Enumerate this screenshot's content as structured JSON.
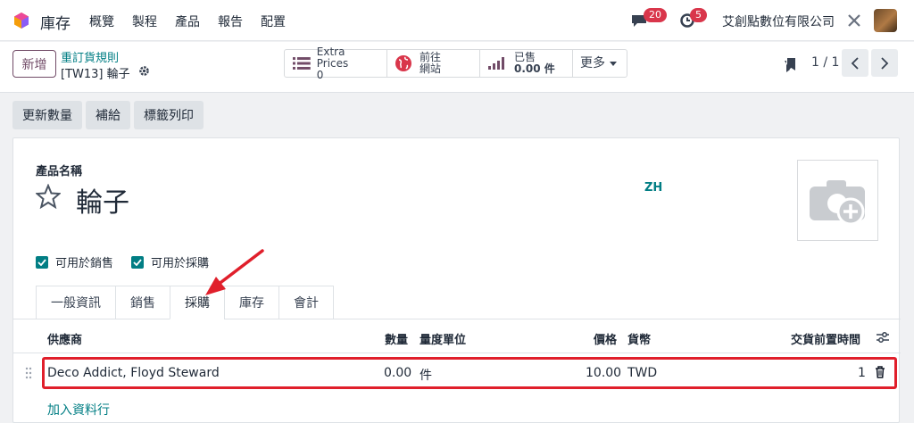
{
  "nav": {
    "app": "庫存",
    "menu": [
      "概覽",
      "製程",
      "產品",
      "報告",
      "配置"
    ],
    "messages_count": "20",
    "activities_count": "5",
    "company": "艾創點數位有限公司"
  },
  "control": {
    "new_label": "新增",
    "breadcrumb_parent": "重訂貨規則",
    "breadcrumb_current": "[TW13] 輪子",
    "pager": "1 / 1"
  },
  "smart_buttons": [
    {
      "line1": "Extra Prices",
      "line2": "0",
      "icon": "list-icon"
    },
    {
      "line1": "前往",
      "line2": "網站",
      "icon": "globe-icon"
    },
    {
      "line1": "已售",
      "line2": "0.00 件",
      "icon": "bar-chart-icon"
    },
    {
      "line1": "更多",
      "icon": "caret-down-icon"
    }
  ],
  "actions": [
    "更新數量",
    "補給",
    "標籤列印"
  ],
  "form": {
    "name_label": "產品名稱",
    "name": "輪子",
    "lang": "ZH",
    "can_sell": "可用於銷售",
    "can_purchase": "可用於採購"
  },
  "tabs": [
    "一般資訊",
    "銷售",
    "採購",
    "庫存",
    "會計"
  ],
  "active_tab": "採購",
  "table": {
    "headers": {
      "vendor": "供應商",
      "qty": "數量",
      "uom": "量度單位",
      "price": "價格",
      "currency": "貨幣",
      "lead": "交貨前置時間"
    },
    "rows": [
      {
        "vendor": "Deco Addict, Floyd Steward",
        "qty": "0.00",
        "uom": "件",
        "price": "10.00",
        "currency": "TWD",
        "lead": "1"
      }
    ],
    "add_line": "加入資料行"
  },
  "colors": {
    "brand": "#714b67",
    "accent": "#017e84",
    "highlight": "#e01f2b"
  }
}
